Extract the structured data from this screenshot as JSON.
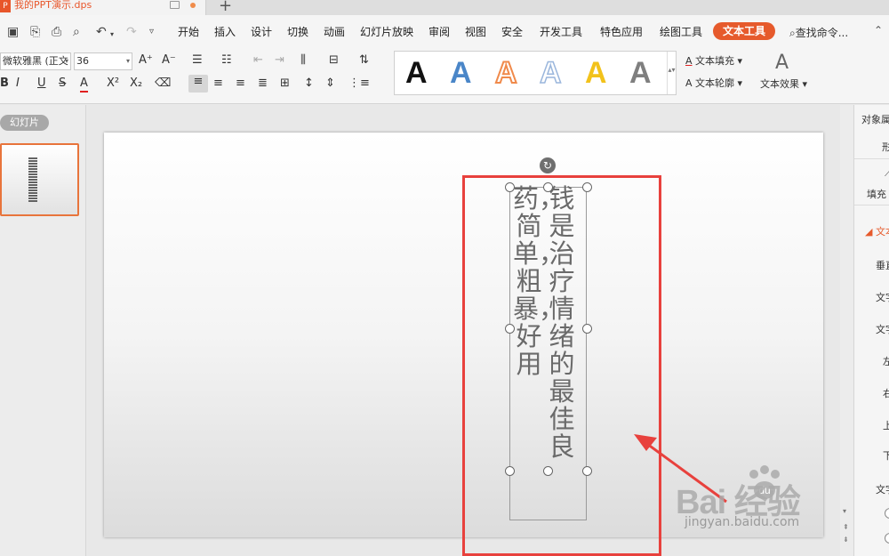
{
  "document": {
    "title": "我的PPT演示.dps",
    "icon": "P"
  },
  "quick_access": [
    "save-icon",
    "format-painter-icon",
    "print-icon",
    "print-preview-icon",
    "undo-icon",
    "redo-icon",
    "more-icon"
  ],
  "menu": {
    "items": [
      "开始",
      "插入",
      "设计",
      "切换",
      "动画",
      "幻灯片放映",
      "审阅",
      "视图",
      "安全",
      "开发工具",
      "特色应用",
      "绘图工具",
      "文本工具"
    ],
    "active": "文本工具",
    "search": "查找命令..."
  },
  "ribbon": {
    "font_name": "微软雅黑 (正文",
    "font_size": "36",
    "gallery_letter": "A",
    "gallery_colors": [
      "#111111",
      "#4a86c8",
      "#f08a4b",
      "#9ab6dc",
      "#f2c21b",
      "#7f7f7f"
    ],
    "text_fill": "文本填充",
    "text_outline": "文本轮廓",
    "text_effect": "文本效果"
  },
  "left_panel": {
    "tab": "幻灯片"
  },
  "slide": {
    "col_right": "钱是治疗情绪的最佳良",
    "col_left": "药，简单，粗暴，好用"
  },
  "right_panel": {
    "title": "对象属",
    "shape_tab": "形",
    "fill_tab": "填充",
    "section": "文本",
    "rows": [
      "垂直",
      "文字",
      "文字",
      "左",
      "右",
      "上",
      "下",
      "文字"
    ]
  },
  "watermark": {
    "brand": "Bai  经验",
    "url": "jingyan.baidu.com"
  },
  "colors": {
    "accent": "#e65a2c",
    "highlight_box": "#e8413d"
  }
}
